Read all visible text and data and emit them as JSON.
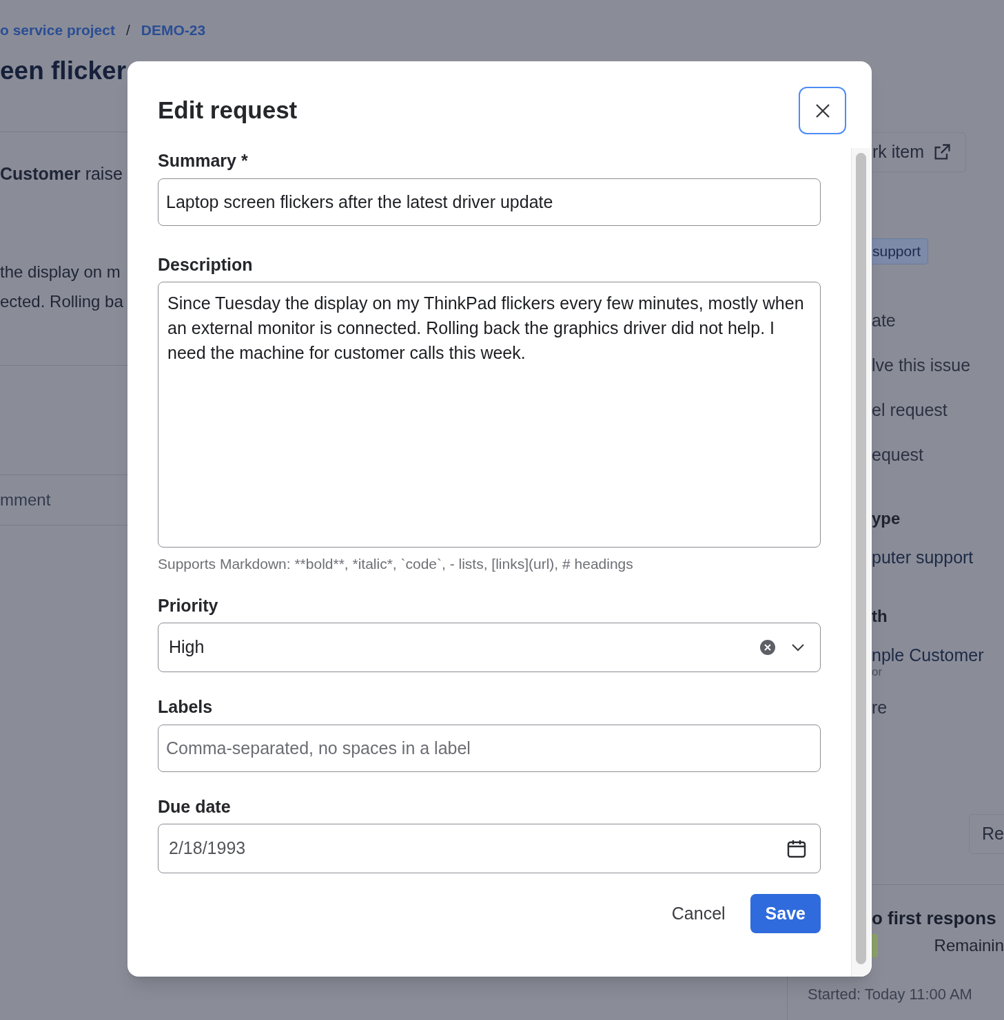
{
  "backdrop": {
    "breadcrumbs": [
      "o service project",
      "DEMO-23"
    ],
    "separator": "/",
    "title": "een flicker",
    "reporter_line": "**Customer** raise",
    "description_lines": [
      "the display on m",
      "ected. Rolling ba"
    ],
    "comment_tab": "mment",
    "work_item_button": "rk item",
    "tag": "support",
    "actions": [
      "ate",
      "lve this issue",
      "el request",
      "equest"
    ],
    "details": [
      {
        "label": "ype",
        "value": "puter support"
      },
      {
        "label": "th",
        "value": "nple Customer",
        "sub": "or"
      }
    ],
    "extra": "re",
    "side_button": "Re",
    "sla": {
      "title": "o first respons",
      "remaining": "Remainin",
      "started": "Started: Today 11:00 AM"
    }
  },
  "dialog": {
    "title": "Edit request",
    "fields": [
      {
        "kind": "text",
        "label": "Summary *",
        "value": "Laptop screen flickers after the latest driver update"
      },
      {
        "kind": "textarea",
        "label": "Description",
        "value": "Since Tuesday the display on my ThinkPad flickers every few minutes, mostly when an external monitor is connected. Rolling back the graphics driver did not help. I need the machine for customer calls this week.",
        "help": "Supports Markdown: **bold**, *italic*, `code`, - lists, [links](url), # headings"
      },
      {
        "kind": "select",
        "label": "Priority",
        "value": "High"
      },
      {
        "kind": "text",
        "label": "Labels",
        "placeholder": "Comma-separated, no spaces in a label"
      },
      {
        "kind": "date",
        "label": "Due date",
        "value": "2/18/1993"
      }
    ],
    "cancel": "Cancel",
    "save": "Save"
  }
}
